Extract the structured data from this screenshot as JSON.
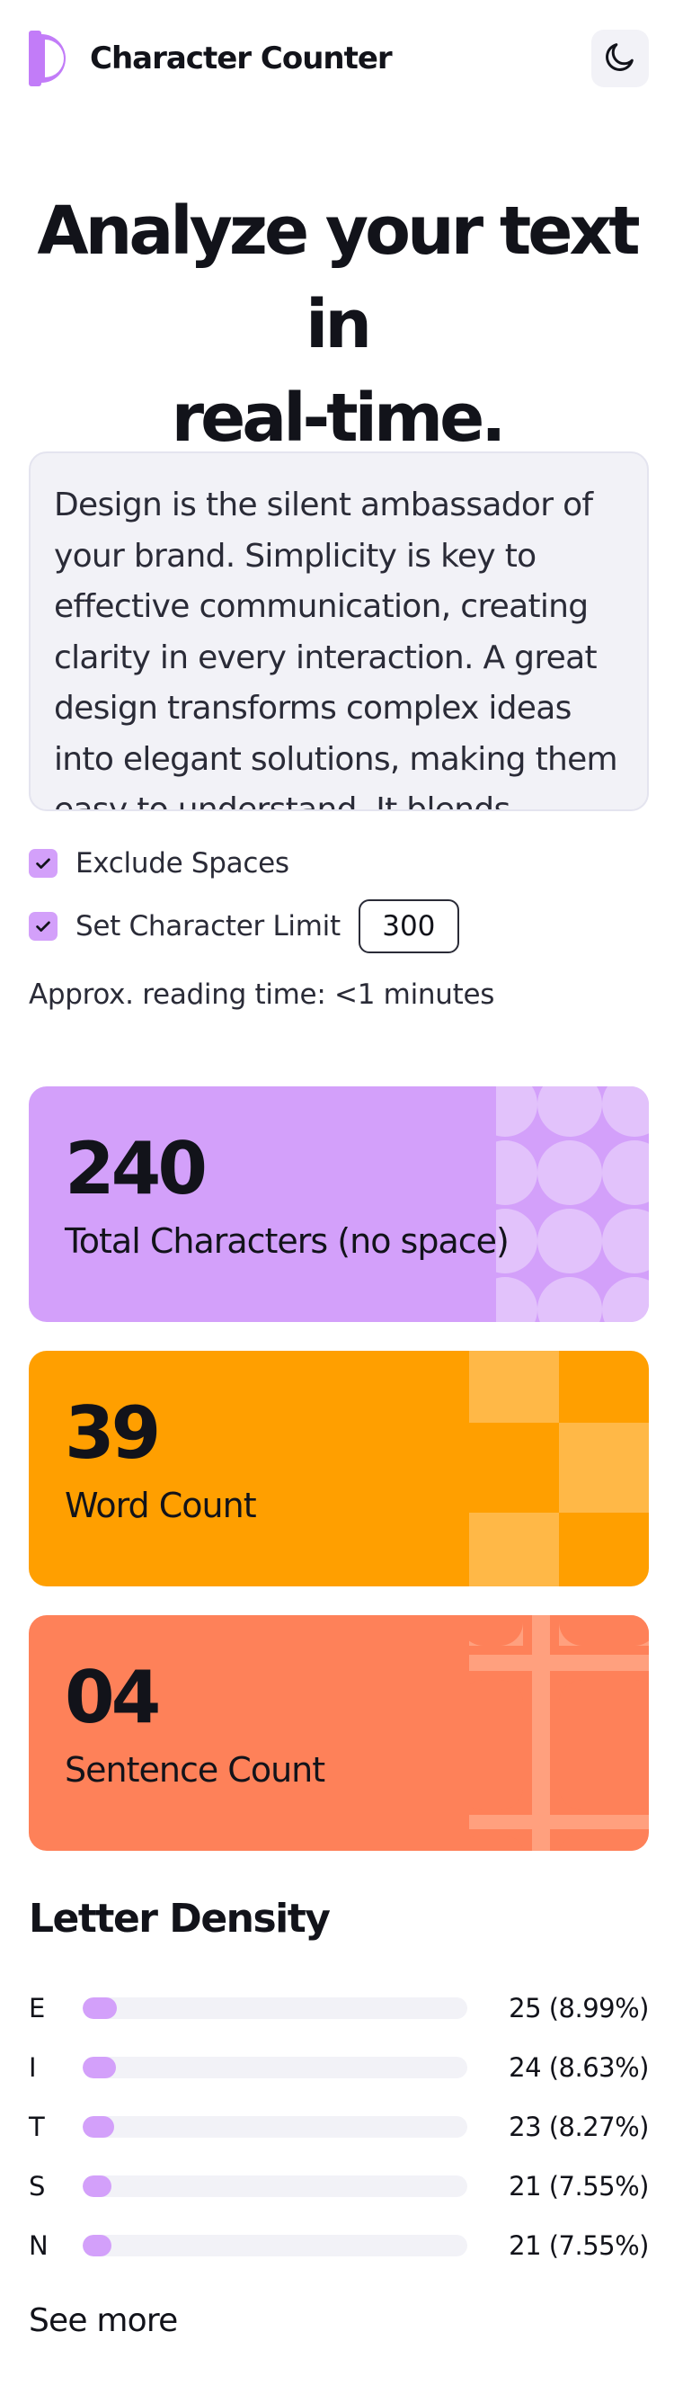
{
  "header": {
    "title": "Character Counter",
    "logo_icon": "half-circle-logo-icon",
    "theme_toggle_icon": "moon-icon",
    "accent": "#c27cf8"
  },
  "hero": {
    "line1": "Analyze your text in",
    "line2": "real-time."
  },
  "textarea": {
    "value": "Design is the silent ambassador of your brand. Simplicity is key to effective communication, creating clarity in every interaction. A great design transforms complex ideas into elegant solutions, making them easy to understand. It blends"
  },
  "options": {
    "exclude_spaces": {
      "label": "Exclude Spaces",
      "checked": true
    },
    "character_limit": {
      "label": "Set Character Limit",
      "checked": true,
      "value": "300"
    },
    "reading_time": "Approx. reading time: <1 minutes"
  },
  "stats": [
    {
      "value": "240",
      "label": "Total Characters (no space)",
      "color": "#d3a0fa"
    },
    {
      "value": "39",
      "label": "Word Count",
      "color": "#ff9f00"
    },
    {
      "value": "04",
      "label": "Sentence Count",
      "color": "#fe8159"
    }
  ],
  "letter_density": {
    "title": "Letter Density",
    "rows": [
      {
        "letter": "E",
        "count": "25 (8.99%)",
        "percent": 8.99
      },
      {
        "letter": "I",
        "count": "24 (8.63%)",
        "percent": 8.63
      },
      {
        "letter": "T",
        "count": "23 (8.27%)",
        "percent": 8.27
      },
      {
        "letter": "S",
        "count": "21 (7.55%)",
        "percent": 7.55
      },
      {
        "letter": "N",
        "count": "21 (7.55%)",
        "percent": 7.55
      }
    ],
    "see_more": "See more"
  }
}
